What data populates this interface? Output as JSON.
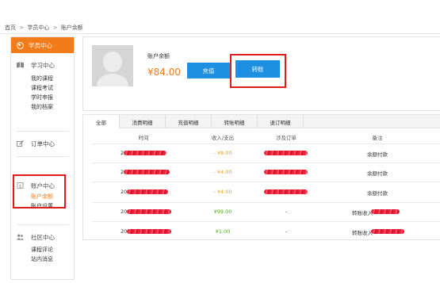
{
  "breadcrumb": [
    "首页",
    "学员中心",
    "账户余额"
  ],
  "breadcrumb_sep": ">",
  "sidebar": {
    "header": "学员中心",
    "sections": [
      {
        "title": "学习中心",
        "icon": "book-icon",
        "items": [
          "我的课程",
          "课程考试",
          "学时申报",
          "我的档案"
        ]
      },
      {
        "title": "订单中心",
        "icon": "edit-icon",
        "items": []
      },
      {
        "title": "账户中心",
        "icon": "dollar-icon",
        "items": [
          "账户余额",
          "账户设置"
        ]
      },
      {
        "title": "社区中心",
        "icon": "users-icon",
        "items": [
          "课程评论",
          "站内消息"
        ]
      }
    ]
  },
  "account": {
    "balance_label": "账户余额",
    "balance_value": "¥84.00",
    "recharge_button": "充值",
    "transfer_button": "转账"
  },
  "tabs": [
    "全部",
    "消费明细",
    "充值明细",
    "转账明细",
    "退订明细"
  ],
  "table": {
    "columns": [
      "时间",
      "收入/支出",
      "涉及订单",
      "备注"
    ],
    "rows": [
      {
        "time": "2",
        "amount": "- ¥8.00",
        "order": "",
        "note": "余额付款"
      },
      {
        "time": "2",
        "amount": "- ¥4.00",
        "order": "",
        "note": "余额付款"
      },
      {
        "time": "20",
        "amount": "- ¥4.00",
        "order": "",
        "note": "余额付款"
      },
      {
        "time": "20",
        "amount": "¥99.00",
        "order": "-",
        "note": "转账收入"
      },
      {
        "time": "20",
        "amount": "¥1.00",
        "order": "-",
        "note": "转账收入"
      }
    ]
  },
  "colors": {
    "accent": "#f27b1a",
    "button": "#1e8fe1",
    "highlight": "#e21b1b",
    "expense": "#f2a01a",
    "income": "#4caf1a"
  }
}
